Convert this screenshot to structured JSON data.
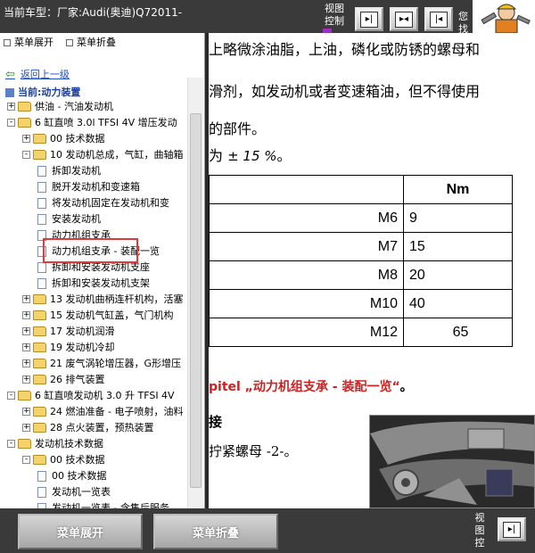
{
  "topbar": {
    "vehicle": "当前车型：厂家:Audi(奥迪)Q72011-",
    "view_control_1": "视图",
    "view_control_2": "控制",
    "you_1": "您",
    "you_2": "找"
  },
  "sidebar": {
    "menu_expand": "菜单展开",
    "menu_collapse": "菜单折叠",
    "back": "返回上一级",
    "current": "当前:动力装置",
    "tree": [
      {
        "label": "供油 - 汽油发动机",
        "indent": 0,
        "kind": "folder",
        "toggle": "+"
      },
      {
        "label": "6 缸直喷 3.0l TFSI 4V 增压发动",
        "indent": 0,
        "kind": "folder",
        "toggle": "-"
      },
      {
        "label": "00 技术数据",
        "indent": 1,
        "kind": "folder",
        "toggle": "+"
      },
      {
        "label": "10 发动机总成，气缸，曲轴箱",
        "indent": 1,
        "kind": "folder",
        "toggle": "-"
      },
      {
        "label": "拆卸发动机",
        "indent": 2,
        "kind": "doc"
      },
      {
        "label": "脱开发动机和变速箱",
        "indent": 2,
        "kind": "doc"
      },
      {
        "label": "将发动机固定在发动机和变",
        "indent": 2,
        "kind": "doc"
      },
      {
        "label": "安装发动机",
        "indent": 2,
        "kind": "doc",
        "selected": true
      },
      {
        "label": "动力机组支承",
        "indent": 2,
        "kind": "doc"
      },
      {
        "label": "动力机组支承 - 装配一览",
        "indent": 2,
        "kind": "doc"
      },
      {
        "label": "拆卸和安装发动机支座",
        "indent": 2,
        "kind": "doc"
      },
      {
        "label": "拆卸和安装发动机支架",
        "indent": 2,
        "kind": "doc"
      },
      {
        "label": "13 发动机曲柄连杆机构，活塞",
        "indent": 1,
        "kind": "folder",
        "toggle": "+"
      },
      {
        "label": "15 发动机气缸盖，气门机构",
        "indent": 1,
        "kind": "folder",
        "toggle": "+"
      },
      {
        "label": "17 发动机润滑",
        "indent": 1,
        "kind": "folder",
        "toggle": "+"
      },
      {
        "label": "19 发动机冷却",
        "indent": 1,
        "kind": "folder",
        "toggle": "+"
      },
      {
        "label": "21 废气涡轮增压器，G形增压",
        "indent": 1,
        "kind": "folder",
        "toggle": "+"
      },
      {
        "label": "26 排气装置",
        "indent": 1,
        "kind": "folder",
        "toggle": "+"
      },
      {
        "label": "6 缸直喷发动机 3.0 升 TFSI 4V",
        "indent": 0,
        "kind": "folder",
        "toggle": "-"
      },
      {
        "label": "24 燃油准备 - 电子喷射，油料",
        "indent": 1,
        "kind": "folder",
        "toggle": "+"
      },
      {
        "label": "28 点火装置，预热装置",
        "indent": 1,
        "kind": "folder",
        "toggle": "+"
      },
      {
        "label": "发动机技术数据",
        "indent": 0,
        "kind": "folder",
        "toggle": "-"
      },
      {
        "label": "00 技术数据",
        "indent": 1,
        "kind": "folder",
        "toggle": "-"
      },
      {
        "label": "00 技术数据",
        "indent": 2,
        "kind": "doc"
      },
      {
        "label": "发动机一览表",
        "indent": 2,
        "kind": "doc"
      },
      {
        "label": "发动机一览表 - 含售后服务",
        "indent": 2,
        "kind": "doc"
      }
    ]
  },
  "content": {
    "line1": "上略微涂油脂，上油，磷化或防锈的螺母和",
    "line2": "滑剂，如发动机或者变速箱油，但不得使用",
    "line3": "的部件。",
    "line4_prefix": "为 ",
    "tolerance": "± 15 %",
    "line4_suffix": "。",
    "table_header_unit": "Nm",
    "table_rows": [
      {
        "thread": "M6",
        "nm": "9"
      },
      {
        "thread": "M7",
        "nm": "15"
      },
      {
        "thread": "M8",
        "nm": "20"
      },
      {
        "thread": "M10",
        "nm": "40"
      },
      {
        "thread": "M12",
        "nm": "65"
      }
    ],
    "pitel_link": "pitel „动力机组支承 - 装配一览“",
    "pitel_dot": "。",
    "jie": "接",
    "nut": "拧紧螺母 -2-。"
  },
  "bottombar": {
    "menu_expand": "菜单展开",
    "menu_collapse": "菜单折叠",
    "view_control_1": "视",
    "view_control_2": "图",
    "view_control_3": "控"
  },
  "colors": {
    "bar_bg": "#3a3a3a",
    "link_red": "#d02020",
    "selection_box": "#e23a3a",
    "tree_link_blue": "#1a4ec2"
  }
}
